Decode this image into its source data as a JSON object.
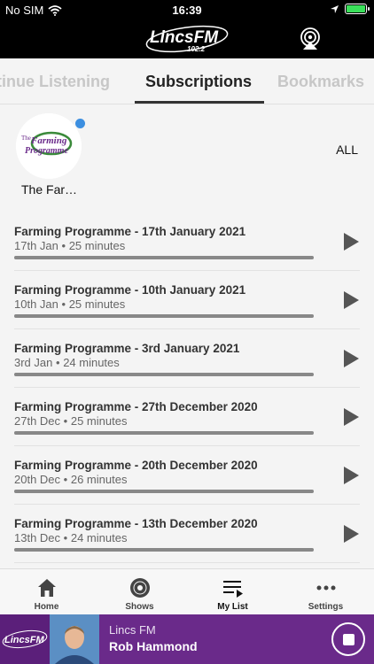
{
  "status_bar": {
    "carrier": "No SIM",
    "time": "16:39"
  },
  "header": {
    "logo_text": "LincsFM",
    "logo_subtext": "102.2"
  },
  "tabs": [
    {
      "label": "Continue Listening",
      "visible_label": "tinue Listening"
    },
    {
      "label": "Subscriptions"
    },
    {
      "label": "Bookmarks"
    }
  ],
  "subscriptions": {
    "item": {
      "label": "The Far…",
      "logo_line1": "The",
      "logo_line2": "Farming",
      "logo_line3": "Programme"
    },
    "all_label": "ALL"
  },
  "episodes": [
    {
      "title": "Farming Programme - 17th January 2021",
      "date": "17th Jan",
      "duration": "25 minutes"
    },
    {
      "title": "Farming Programme - 10th January 2021",
      "date": "10th Jan",
      "duration": "25 minutes"
    },
    {
      "title": "Farming Programme - 3rd January 2021",
      "date": "3rd Jan",
      "duration": "24 minutes"
    },
    {
      "title": "Farming Programme - 27th December 2020",
      "date": "27th Dec",
      "duration": "25 minutes"
    },
    {
      "title": "Farming Programme - 20th December 2020",
      "date": "20th Dec",
      "duration": "26 minutes"
    },
    {
      "title": "Farming Programme - 13th December 2020",
      "date": "13th Dec",
      "duration": "24 minutes"
    }
  ],
  "meta_separator": "•",
  "bottom_nav": [
    {
      "label": "Home"
    },
    {
      "label": "Shows"
    },
    {
      "label": "My List"
    },
    {
      "label": "Settings"
    }
  ],
  "player": {
    "station": "Lincs FM",
    "presenter": "Rob Hammond",
    "art_logo_text": "LincsFM"
  },
  "colors": {
    "accent": "#6a2a8a",
    "subscription_dot": "#3c8fe0",
    "battery": "#3ae05a"
  }
}
